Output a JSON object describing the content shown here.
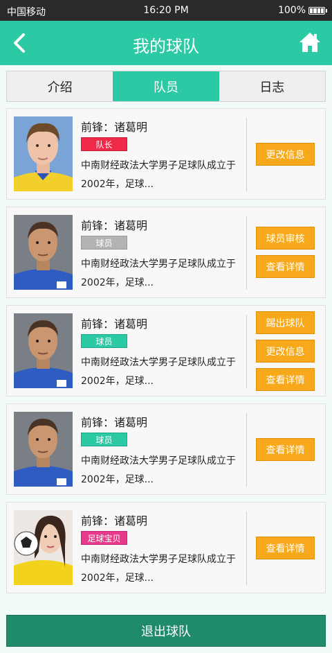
{
  "status": {
    "carrier": "中国移动",
    "time": "16:20 PM",
    "battery": "100%"
  },
  "header": {
    "title": "我的球队",
    "back_icon": "chevron-left-icon",
    "home_icon": "home-icon"
  },
  "tabs": [
    {
      "label": "介绍",
      "active": false
    },
    {
      "label": "队员",
      "active": true
    },
    {
      "label": "日志",
      "active": false
    }
  ],
  "members": [
    {
      "name": "前锋：诸葛明",
      "badge": "队长",
      "badge_color": "#ee2a48",
      "desc_line1": "中南财经政法大学男子足球队成立于",
      "desc_line2": "2002年，足球...",
      "buttons": [
        "更改信息"
      ]
    },
    {
      "name": "前锋：诸葛明",
      "badge": "球员",
      "badge_color": "#b3b3b3",
      "desc_line1": "中南财经政法大学男子足球队成立于",
      "desc_line2": "2002年，足球...",
      "buttons": [
        "球员审核",
        "查看详情"
      ]
    },
    {
      "name": "前锋：诸葛明",
      "badge": "球员",
      "badge_color": "#2bc9a4",
      "desc_line1": "中南财经政法大学男子足球队成立于",
      "desc_line2": "2002年，足球...",
      "buttons": [
        "踢出球队",
        "更改信息",
        "查看详情"
      ]
    },
    {
      "name": "前锋：诸葛明",
      "badge": "球员",
      "badge_color": "#2bc9a4",
      "desc_line1": "中南财经政法大学男子足球队成立于",
      "desc_line2": "2002年，足球...",
      "buttons": [
        "查看详情"
      ]
    },
    {
      "name": "前锋：诸葛明",
      "badge": "足球宝贝",
      "badge_color": "#e83a8c",
      "desc_line1": "中南财经政法大学男子足球队成立于",
      "desc_line2": "2002年，足球...",
      "buttons": [
        "查看详情"
      ]
    }
  ],
  "footer": {
    "quit_label": "退出球队"
  },
  "colors": {
    "accent": "#2bc9a4",
    "button": "#f8a81b",
    "quit": "#1f8b6a"
  }
}
